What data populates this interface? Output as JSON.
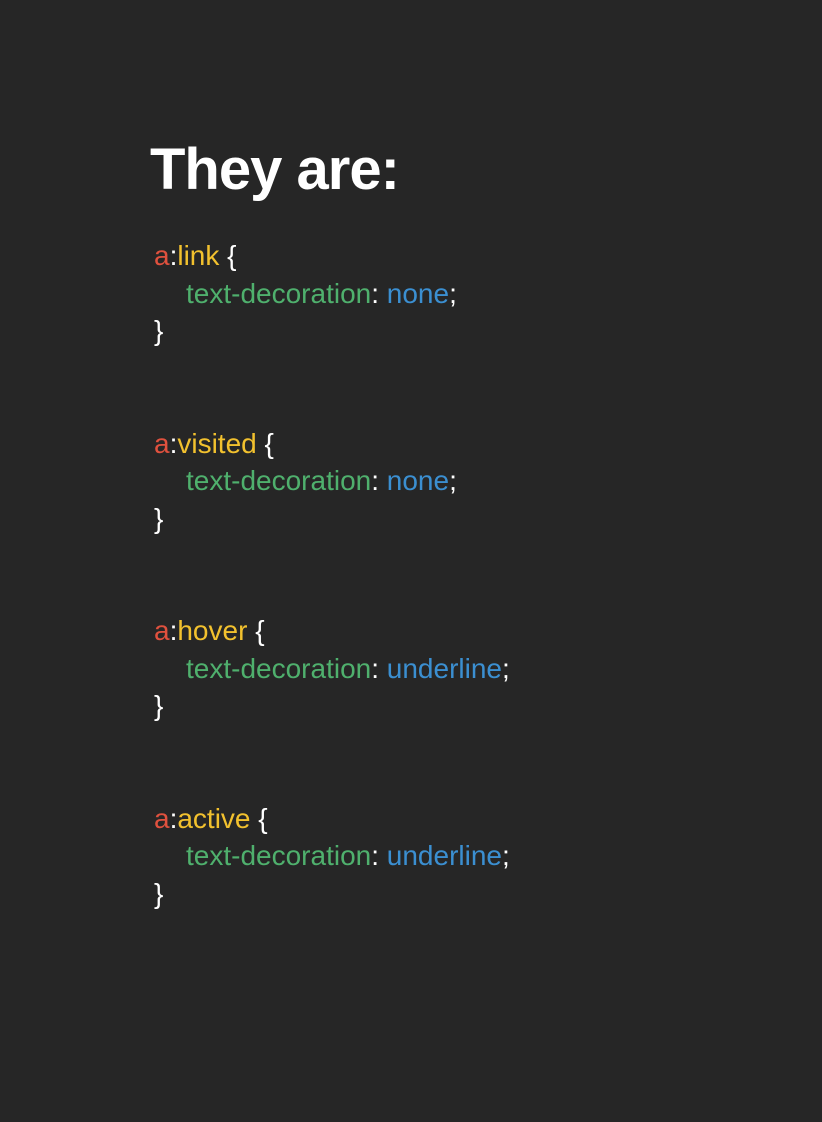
{
  "heading": "They are:",
  "colors": {
    "background": "#262626",
    "element": "#e0513e",
    "pseudo_class": "#f2c12e",
    "property": "#4fb06d",
    "value": "#3b8fd1",
    "punctuation": "#ffffff"
  },
  "rules": [
    {
      "element": "a",
      "colon": ":",
      "pseudo": "link",
      "open": "{",
      "property": "text-decoration",
      "sep": ":",
      "value": "none",
      "semi": ";",
      "close": "}"
    },
    {
      "element": "a",
      "colon": ":",
      "pseudo": "visited",
      "open": "{",
      "property": "text-decoration",
      "sep": ":",
      "value": "none",
      "semi": ";",
      "close": "}"
    },
    {
      "element": "a",
      "colon": ":",
      "pseudo": "hover",
      "open": "{",
      "property": "text-decoration",
      "sep": ":",
      "value": "underline",
      "semi": ";",
      "close": "}"
    },
    {
      "element": "a",
      "colon": ":",
      "pseudo": "active",
      "open": "{",
      "property": "text-decoration",
      "sep": ":",
      "value": "underline",
      "semi": ";",
      "close": "}"
    }
  ]
}
